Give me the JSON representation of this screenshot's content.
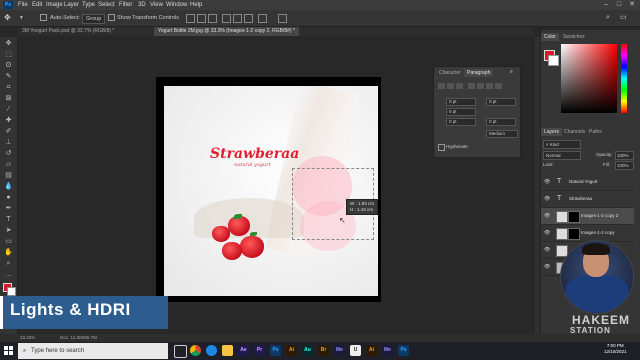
{
  "menu": {
    "items": [
      "File",
      "Edit",
      "Image",
      "Layer",
      "Type",
      "Select",
      "Filter",
      "3D",
      "View",
      "Window",
      "Help"
    ]
  },
  "options_bar": {
    "auto_select_label": "Auto-Select:",
    "auto_select_value": "Group",
    "show_transform_label": "Show Transform Controls"
  },
  "tabs": [
    {
      "label": "3M Yoogurt Pack.psd @ 33.7% (RGB/8) *",
      "active": false
    },
    {
      "label": "Yogurt Bottle 2M.jpg @ 33.3% (Images-1-2 copy 2, RGB/8#) *",
      "active": true
    }
  ],
  "artwork": {
    "title": "Strawberaa",
    "subtitle": "natural yogurt"
  },
  "transform_tooltip": {
    "line1": "W : 1.93 cm",
    "line2": "H : 1.43 cm"
  },
  "char_panel": {
    "tab_character": "Character",
    "tab_paragraph": "Paragraph",
    "fields": [
      "0 pt",
      "0 pt",
      "0 pt",
      "0 pt",
      "0 pt"
    ],
    "dropdown_value": "Medium",
    "hyphenate_label": "Hyphenate"
  },
  "right_panel": {
    "tab_color": "Color",
    "tab_swatches": "Swatches",
    "tab_layers": "Layers",
    "tab_channels": "Channels",
    "tab_paths": "Paths",
    "filter_kind": "Kind",
    "blend_mode": "Normal",
    "opacity_label": "Opacity:",
    "opacity_value": "100%",
    "lock_label": "Lock:",
    "fill_label": "Fill:",
    "fill_value": "100%",
    "layers": [
      {
        "name": "Natural Yogurt",
        "type": "text",
        "selected": false
      },
      {
        "name": "Strawberaa",
        "type": "text",
        "selected": false
      },
      {
        "name": "Images-1-2 copy 2",
        "type": "image",
        "selected": true
      },
      {
        "name": "Images-1-2 copy",
        "type": "image",
        "selected": false
      },
      {
        "name": "",
        "type": "image",
        "selected": false
      },
      {
        "name": "",
        "type": "image",
        "selected": false
      }
    ],
    "colors": {
      "foreground": "#d8192a",
      "background": "#ffffff"
    }
  },
  "status": {
    "zoom": "33.33%",
    "doc_info": "Doc: 12.0M/95.7M"
  },
  "overlay": {
    "course_title": "Lights & HDRI"
  },
  "watermark": {
    "line1": "HAKEEM",
    "line2": "STATION"
  },
  "taskbar": {
    "search_placeholder": "Type here to search",
    "icons": [
      "task-view",
      "chrome",
      "edge",
      "file-explorer",
      "after-effects",
      "premiere",
      "photoshop",
      "illustrator",
      "audition",
      "bridge",
      "media-encoder",
      "unreal",
      "illustrator-2",
      "media-encoder-2",
      "photoshop-2"
    ],
    "time": "7:00 PM",
    "date": "12/10/2021"
  }
}
